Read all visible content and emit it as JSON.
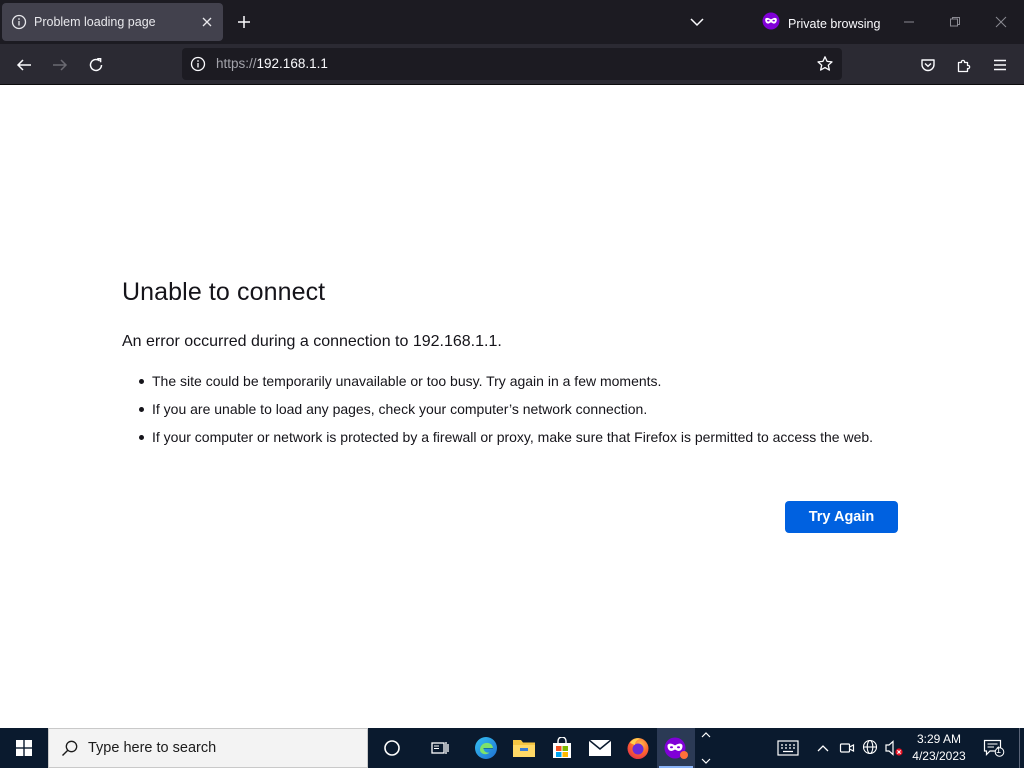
{
  "tab": {
    "title": "Problem loading page"
  },
  "private": {
    "label": "Private browsing"
  },
  "urlbar": {
    "scheme": "https://",
    "host": "192.168.1.1"
  },
  "error": {
    "title": "Unable to connect",
    "description": "An error occurred during a connection to 192.168.1.1.",
    "items": [
      "The site could be temporarily unavailable or too busy. Try again in a few moments.",
      "If you are unable to load any pages, check your computer’s network connection.",
      "If your computer or network is protected by a firewall or proxy, make sure that Firefox is permitted to access the web."
    ],
    "button": "Try Again"
  },
  "taskbar": {
    "search_placeholder": "Type here to search",
    "time": "3:29 AM",
    "date": "4/23/2023",
    "notification_count": "1",
    "pinned": [
      "cortana-icon",
      "task-view-icon",
      "edge-icon",
      "file-explorer-icon",
      "store-icon",
      "mail-icon",
      "firefox-icon",
      "firefox-private-icon"
    ]
  },
  "colors": {
    "tabstrip": "#1c1b22",
    "navbar": "#2b2a33",
    "accent": "#0061e0",
    "taskbar": "#0a1a2e",
    "private_purple": "#8000d7"
  }
}
